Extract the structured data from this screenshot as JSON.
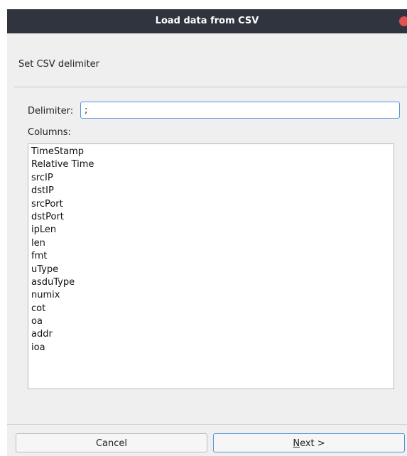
{
  "window": {
    "title": "Load data from CSV"
  },
  "page": {
    "header": "Set CSV delimiter"
  },
  "delimiter": {
    "label": "Delimiter:",
    "value": ";"
  },
  "columns": {
    "label": "Columns:",
    "items": [
      "TimeStamp",
      "Relative Time",
      "srcIP",
      "dstIP",
      "srcPort",
      "dstPort",
      "ipLen",
      "len",
      "fmt",
      "uType",
      "asduType",
      "numix",
      "cot",
      "oa",
      "addr",
      "ioa"
    ]
  },
  "buttons": {
    "cancel": "Cancel",
    "next_mnemonic": "N",
    "next_rest": "ext >"
  },
  "colors": {
    "titlebar": "#2f343f",
    "accent": "#5294e2",
    "close": "#e25252"
  }
}
